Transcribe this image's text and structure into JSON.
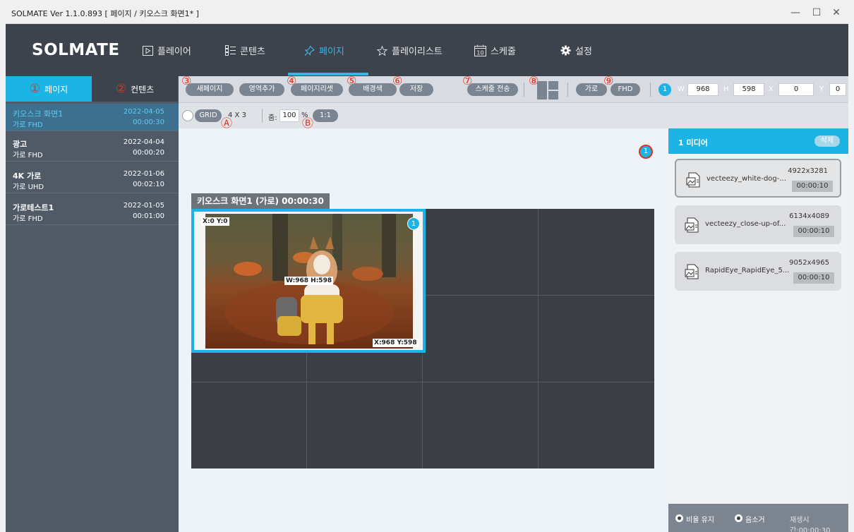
{
  "window": {
    "title": "SOLMATE Ver 1.1.0.893  [ 페이지 / 키오스크 화면1* ]",
    "minimize": "—",
    "maximize": "☐",
    "close": "✕"
  },
  "brand": {
    "logo": "SOLMATE"
  },
  "nav": {
    "items": [
      {
        "label": "플레이어",
        "icon": "play-icon"
      },
      {
        "label": "콘텐츠",
        "icon": "list-icon"
      },
      {
        "label": "페이지",
        "icon": "pin-icon"
      },
      {
        "label": "플레이리스트",
        "icon": "star-icon"
      },
      {
        "label": "스케줄",
        "icon": "calendar-icon"
      },
      {
        "label": "설정",
        "icon": "gear-icon"
      }
    ],
    "calendar_day": "10",
    "accent": "#35b7e6"
  },
  "sidebar": {
    "tabs": [
      {
        "num": "①",
        "label": "페이지"
      },
      {
        "num": "②",
        "label": "컨텐츠"
      }
    ],
    "pages": [
      {
        "name": "키오스크 화면1",
        "date": "2022-04-05",
        "info": "가로  FHD",
        "duration": "00:00:30"
      },
      {
        "name": "광고",
        "date": "2022-04-04",
        "info": "가로  FHD",
        "duration": "00:00:20"
      },
      {
        "name": "4K 가로",
        "date": "2022-01-06",
        "info": "가로  UHD",
        "duration": "00:02:10"
      },
      {
        "name": "가로테스트1",
        "date": "2022-01-05",
        "info": "가로  FHD",
        "duration": "00:01:00"
      }
    ]
  },
  "toolbar": {
    "new_page": "새페이지",
    "add_region": "영역추가",
    "page_reset": "페이지리셋",
    "bg_color": "배경색",
    "save": "저장",
    "send_schedule": "스케줄 전송",
    "orientation": "가로",
    "resolution": "FHD",
    "region_index": "1",
    "w_label": "W",
    "w_value": "968",
    "h_label": "H",
    "h_value": "598",
    "x_label": "X",
    "x_value": "0",
    "y_label": "Y",
    "y_value": "0",
    "markers": [
      "③",
      "④",
      "⑤",
      "⑥",
      "⑦",
      "⑧",
      "⑨"
    ]
  },
  "toolbar2": {
    "grid_label": "GRID",
    "grid_size": "4 X 3",
    "zoom_label": "줌:",
    "zoom_value": "100",
    "zoom_unit": "%",
    "ratio_button": "1:1",
    "markers": [
      "Ⓐ",
      "Ⓑ"
    ]
  },
  "canvas": {
    "page_label": "키오스크 화면1 (가로)   00:00:30",
    "region_badge": "1",
    "floating_badge": "1",
    "coord_top_left": "X:0 Y:0",
    "coord_size": "W:968 H:598",
    "coord_bottom_right": "X:968 Y:598"
  },
  "media_panel": {
    "title": "1 미디어",
    "delete": "삭제",
    "items": [
      {
        "name": "vecteezy_white-dog-...",
        "resolution": "4922x3281",
        "duration": "00:00:10"
      },
      {
        "name": "vecteezy_close-up-of...",
        "resolution": "6134x4089",
        "duration": "00:00:10"
      },
      {
        "name": "RapidEye_RapidEye_5...",
        "resolution": "9052x4965",
        "duration": "00:00:10"
      }
    ],
    "keep_ratio": "비율 유지",
    "remove_audio": "음소거",
    "playtime": "재생시간:00:00:30"
  }
}
